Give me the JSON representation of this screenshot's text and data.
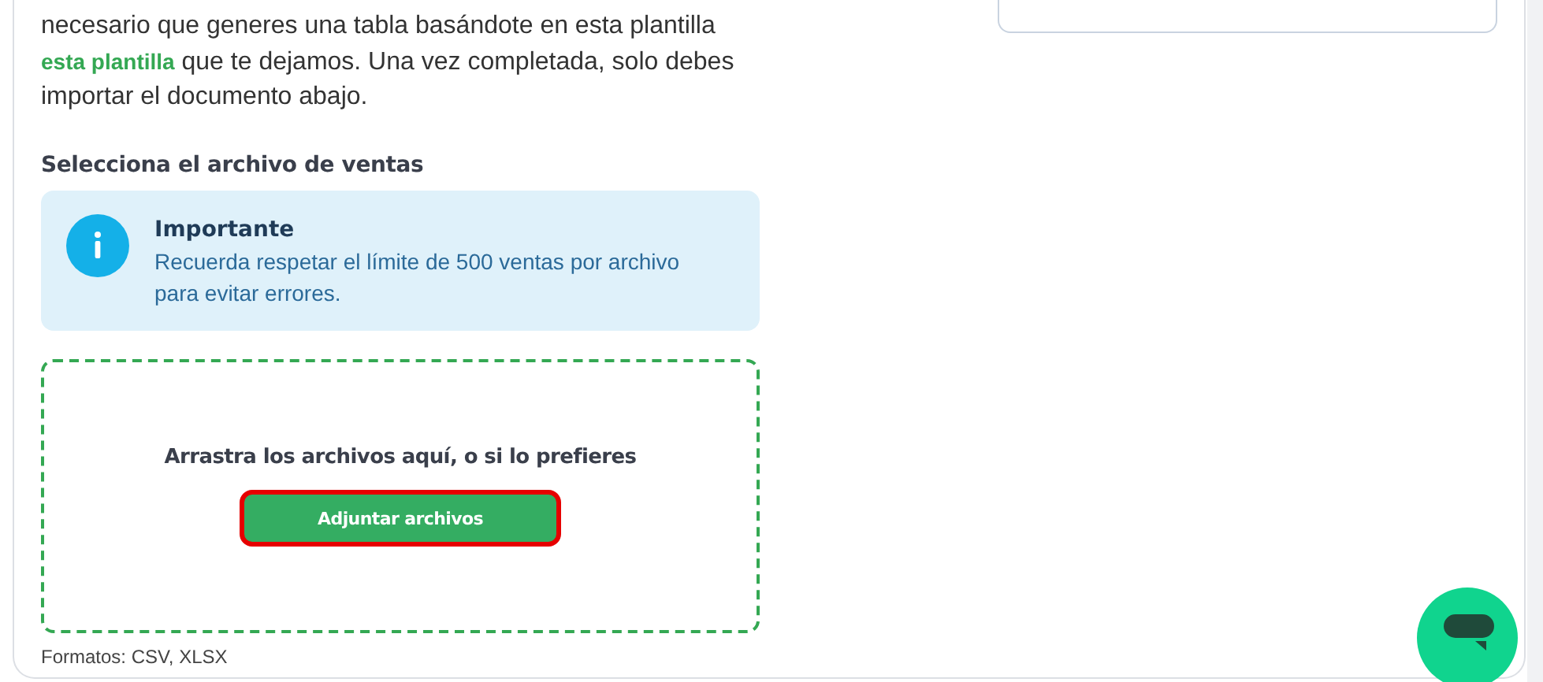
{
  "intro": {
    "lines": [
      "necesario que generes una tabla basándote en esta plantilla",
      "**esta plantilla** que te dejamos. Una vez completada, solo debes",
      "importar el documento abajo."
    ]
  },
  "section_title": "Selecciona el archivo de ventas",
  "notice": {
    "title": "Importante",
    "text": "Recuerda respetar el límite de 500 ventas por archivo para evitar errores."
  },
  "dropzone": {
    "prompt": "Arrastra los archivos aquí, o si lo prefieres",
    "button": "Adjuntar archivos",
    "formats": "Formatos: CSV, XLSX"
  }
}
